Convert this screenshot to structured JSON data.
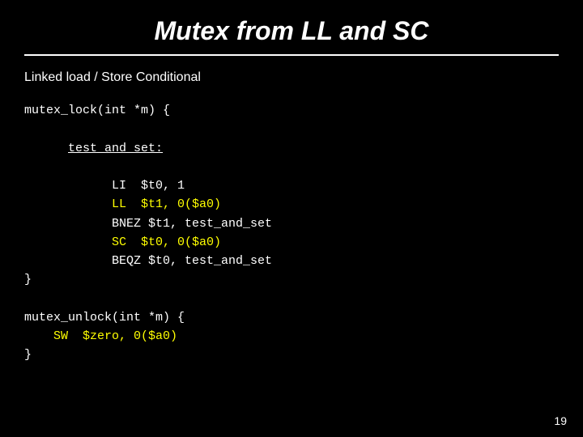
{
  "slide": {
    "title": "Mutex from LL and SC",
    "subtitle": "Linked load / Store Conditional",
    "slide_number": "19",
    "code": {
      "mutex_lock_signature": "mutex_lock(int *m) {",
      "label_test_and_set": "test_and_set:",
      "line_li": "    LI  $t0, 1",
      "line_ll": "    LL  $t1, 0($a0)",
      "line_bnez": "    BNEZ $t1, test_and_set",
      "line_sc": "    SC  $t0, 0($a0)",
      "line_beqz": "    BEQZ $t0, test_and_set",
      "close_brace1": "}",
      "mutex_unlock_signature": "mutex_unlock(int *m) {",
      "line_sw": "  SW  $zero, 0($a0)",
      "close_brace2": "}"
    }
  }
}
